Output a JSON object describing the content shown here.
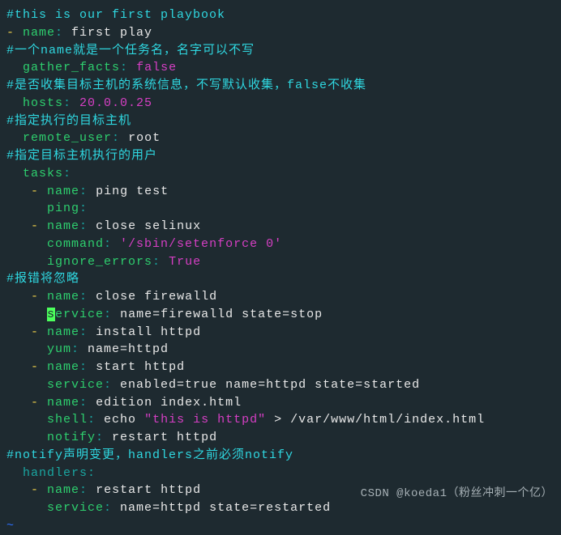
{
  "l1_comment": "#this is our first playbook",
  "l2_dash": "- ",
  "l2_key": "name",
  "l2_colon": ": ",
  "l2_val": "first play",
  "l3_comment": "#一个name就是一个任务名，名字可以不写",
  "l4_indent": "  ",
  "l4_key": "gather_facts",
  "l4_colon": ": ",
  "l4_val": "false",
  "l5_comment": "#是否收集目标主机的系统信息，不写默认收集，false不收集",
  "l6_indent": "  ",
  "l6_key": "hosts",
  "l6_colon": ": ",
  "l6_val": "20.0.0.25",
  "l7_comment": "#指定执行的目标主机",
  "l8_indent": "  ",
  "l8_key": "remote_user",
  "l8_colon": ": ",
  "l8_val": "root",
  "l9_comment": "#指定目标主机执行的用户",
  "l10_indent": "  ",
  "l10_key": "tasks",
  "l10_colon": ":",
  "l11_indent": "   ",
  "l11_dash": "- ",
  "l11_key": "name",
  "l11_colon": ": ",
  "l11_val": "ping test",
  "l12_indent": "     ",
  "l12_key": "ping",
  "l12_colon": ":",
  "l13_indent": "   ",
  "l13_dash": "- ",
  "l13_key": "name",
  "l13_colon": ": ",
  "l13_val": "close selinux",
  "l14_indent": "     ",
  "l14_key": "command",
  "l14_colon": ": ",
  "l14_val": "'/sbin/setenforce 0'",
  "l15_indent": "     ",
  "l15_key": "ignore_errors",
  "l15_colon": ": ",
  "l15_val": "True",
  "l16_comment": "#报错将忽略",
  "l17_indent": "   ",
  "l17_dash": "- ",
  "l17_key": "name",
  "l17_colon": ": ",
  "l17_val": "close firewalld",
  "l18_indent": "     ",
  "l18_cursor": "s",
  "l18_key": "ervice",
  "l18_colon": ": ",
  "l18_val": "name=firewalld state=stop",
  "l19_indent": "   ",
  "l19_dash": "- ",
  "l19_key": "name",
  "l19_colon": ": ",
  "l19_val": "install httpd",
  "l20_indent": "     ",
  "l20_key": "yum",
  "l20_colon": ": ",
  "l20_val": "name=httpd",
  "l21_indent": "   ",
  "l21_dash": "- ",
  "l21_key": "name",
  "l21_colon": ": ",
  "l21_val": "start httpd",
  "l22_indent": "     ",
  "l22_key": "service",
  "l22_colon": ": ",
  "l22_val": "enabled=true name=httpd state=started",
  "l23_indent": "   ",
  "l23_dash": "- ",
  "l23_key": "name",
  "l23_colon": ": ",
  "l23_val": "edition index.html",
  "l24_indent": "     ",
  "l24_key": "shell",
  "l24_colon": ": ",
  "l24_val1": "echo ",
  "l24_str": "\"this is httpd\"",
  "l24_val2": " > /var/www/html/index.html",
  "l25_indent": "     ",
  "l25_key": "notify",
  "l25_colon": ": ",
  "l25_val": "restart httpd",
  "l26_comment": "#notify声明变更，handlers之前必须notify",
  "l27_indent": "  ",
  "l27_key": "handlers",
  "l27_colon": ":",
  "l28_indent": "   ",
  "l28_dash": "- ",
  "l28_key": "name",
  "l28_colon": ": ",
  "l28_val": "restart httpd",
  "l29_indent": "     ",
  "l29_key": "service",
  "l29_colon": ": ",
  "l29_val": "name=httpd state=restarted",
  "tilde": "~",
  "watermark": "CSDN @koeda1（粉丝冲刺一个亿）"
}
